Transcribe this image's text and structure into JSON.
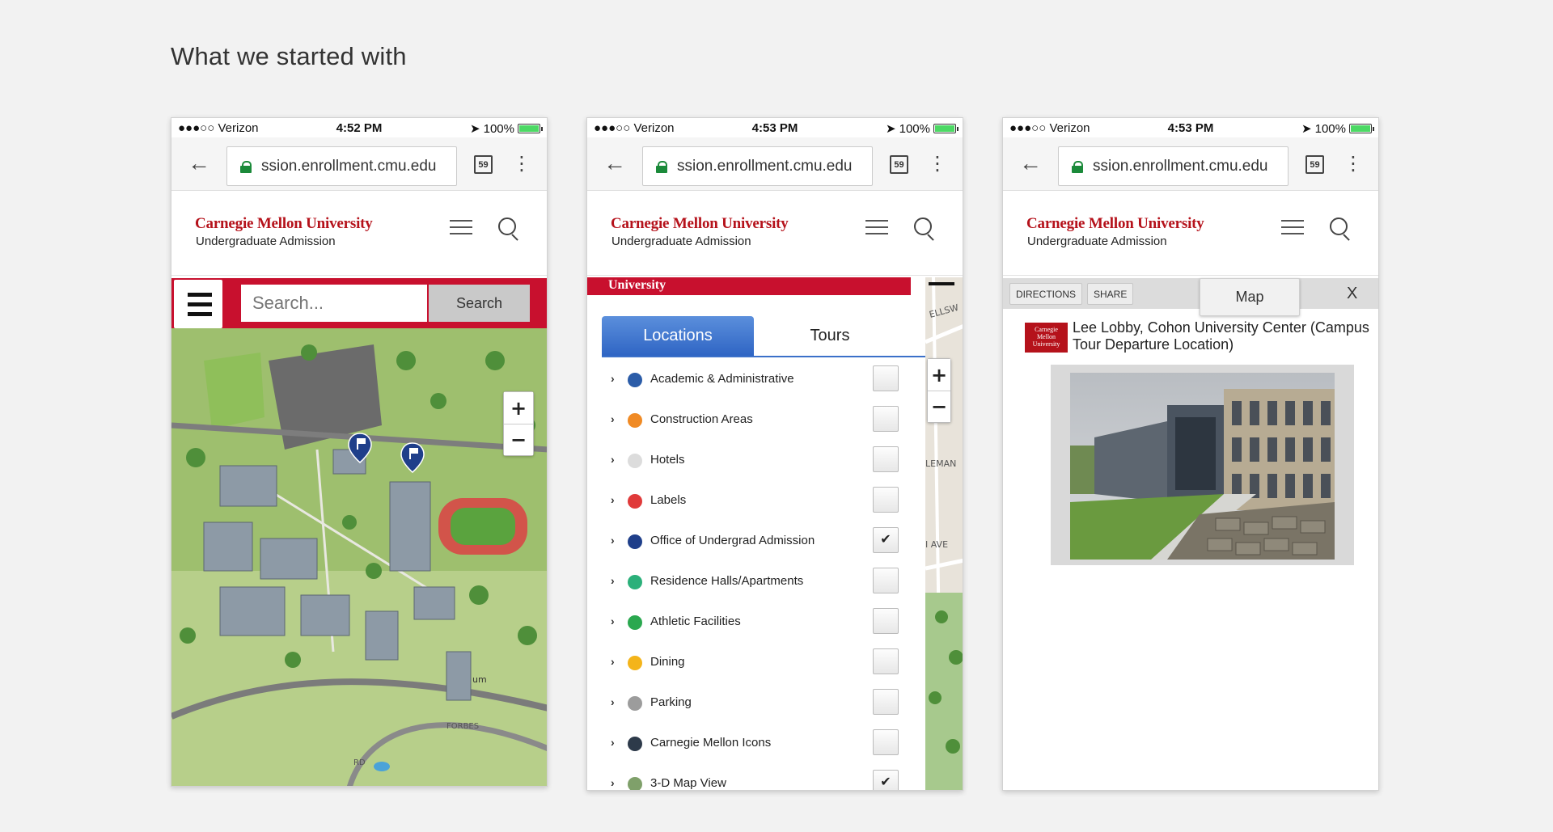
{
  "page_title": "What we started with",
  "phones": [
    {
      "status": {
        "carrier": "●●●○○ Verizon",
        "time": "4:52 PM",
        "battery": "100%",
        "battery_level": 1.0
      },
      "browser": {
        "url": "ssion.enrollment.cmu.edu",
        "tab_count": "59"
      },
      "header": {
        "brand": "Carnegie Mellon University",
        "subtitle": "Undergraduate Admission"
      }
    },
    {
      "status": {
        "carrier": "●●●○○ Verizon",
        "time": "4:53 PM",
        "battery": "100%",
        "battery_level": 1.0
      },
      "browser": {
        "url": "ssion.enrollment.cmu.edu",
        "tab_count": "59"
      },
      "header": {
        "brand": "Carnegie Mellon University",
        "subtitle": "Undergraduate Admission"
      }
    },
    {
      "status": {
        "carrier": "●●●○○ Verizon",
        "time": "4:53 PM",
        "battery": "100%",
        "battery_level": 1.0
      },
      "browser": {
        "url": "ssion.enrollment.cmu.edu",
        "tab_count": "59"
      },
      "header": {
        "brand": "Carnegie Mellon University",
        "subtitle": "Undergraduate Admission"
      }
    }
  ],
  "map_view": {
    "search_placeholder": "Search...",
    "search_button": "Search",
    "zoom_in": "+",
    "zoom_out": "−",
    "map_labels": {
      "street1": "FORBES",
      "street2": "um",
      "road": "RD"
    }
  },
  "layers_view": {
    "strip_text": "University",
    "tabs": [
      {
        "label": "Locations",
        "active": true
      },
      {
        "label": "Tours",
        "active": false
      }
    ],
    "layers": [
      {
        "label": "Academic & Administrative",
        "color": "#2b5ca8",
        "checked": false
      },
      {
        "label": "Construction Areas",
        "color": "#f08a24",
        "checked": false
      },
      {
        "label": "Hotels",
        "color": "#dcdcdc",
        "checked": false
      },
      {
        "label": "Labels",
        "color": "#e03a3a",
        "checked": false
      },
      {
        "label": "Office of Undergrad Admission",
        "color": "#1f3f8a",
        "checked": true
      },
      {
        "label": "Residence Halls/Apartments",
        "color": "#2bb07a",
        "checked": false
      },
      {
        "label": "Athletic Facilities",
        "color": "#2aa84f",
        "checked": false
      },
      {
        "label": "Dining",
        "color": "#f4b41a",
        "checked": false
      },
      {
        "label": "Parking",
        "color": "#9c9c9c",
        "checked": false
      },
      {
        "label": "Carnegie Mellon Icons",
        "color": "#2d3a4a",
        "checked": false
      },
      {
        "label": "3-D Map View",
        "color": "#7fa06a",
        "checked": true
      }
    ],
    "check_mark": "✔",
    "side_map_labels": {
      "a": "ELLSW",
      "b": "LEMAN",
      "c": "I AVE"
    },
    "zoom_in": "+",
    "zoom_out": "−"
  },
  "detail_view": {
    "directions_button": "DIRECTIONS",
    "share_button": "SHARE",
    "map_tab": "Map",
    "close": "X",
    "logo_text": "Carnegie Mellon University",
    "location_title": "Lee Lobby, Cohon University Center (Campus Tour Departure Location)"
  }
}
